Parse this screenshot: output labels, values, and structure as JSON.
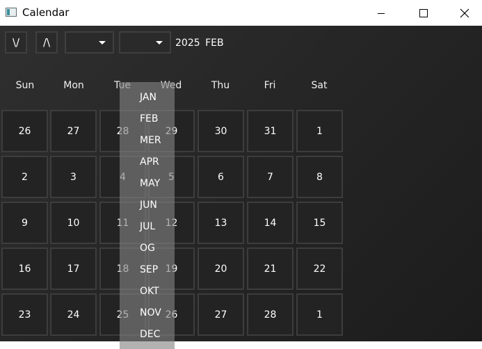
{
  "window": {
    "title": "Calendar",
    "icon": "app-icon",
    "controls": [
      "minimize-icon",
      "maximize-icon",
      "close-icon"
    ]
  },
  "toolbar": {
    "prev_label": "\\/",
    "next_label": "/\\",
    "year_value": "",
    "month_value": "",
    "current_year": "2025",
    "current_month": "FEB"
  },
  "day_names": [
    "Sun",
    "Mon",
    "Tue",
    "Wed",
    "Thu",
    "Fri",
    "Sat"
  ],
  "weeks": [
    [
      "26",
      "27",
      "28",
      "29",
      "30",
      "31",
      "1"
    ],
    [
      "2",
      "3",
      "4",
      "5",
      "6",
      "7",
      "8"
    ],
    [
      "9",
      "10",
      "11",
      "12",
      "13",
      "14",
      "15"
    ],
    [
      "16",
      "17",
      "18",
      "19",
      "20",
      "21",
      "22"
    ],
    [
      "23",
      "24",
      "25",
      "26",
      "27",
      "28",
      "1"
    ]
  ],
  "month_dropdown": {
    "options": [
      "JAN",
      "FEB",
      "MER",
      "APR",
      "MAY",
      "JUN",
      "JUL",
      "OG",
      "SEP",
      "OKT",
      "NOV",
      "DEC"
    ]
  },
  "colors": {
    "background": "#262626",
    "cell_border": "#3d3d3d",
    "dropdown": "#8a8a8a",
    "text": "#ffffff"
  }
}
